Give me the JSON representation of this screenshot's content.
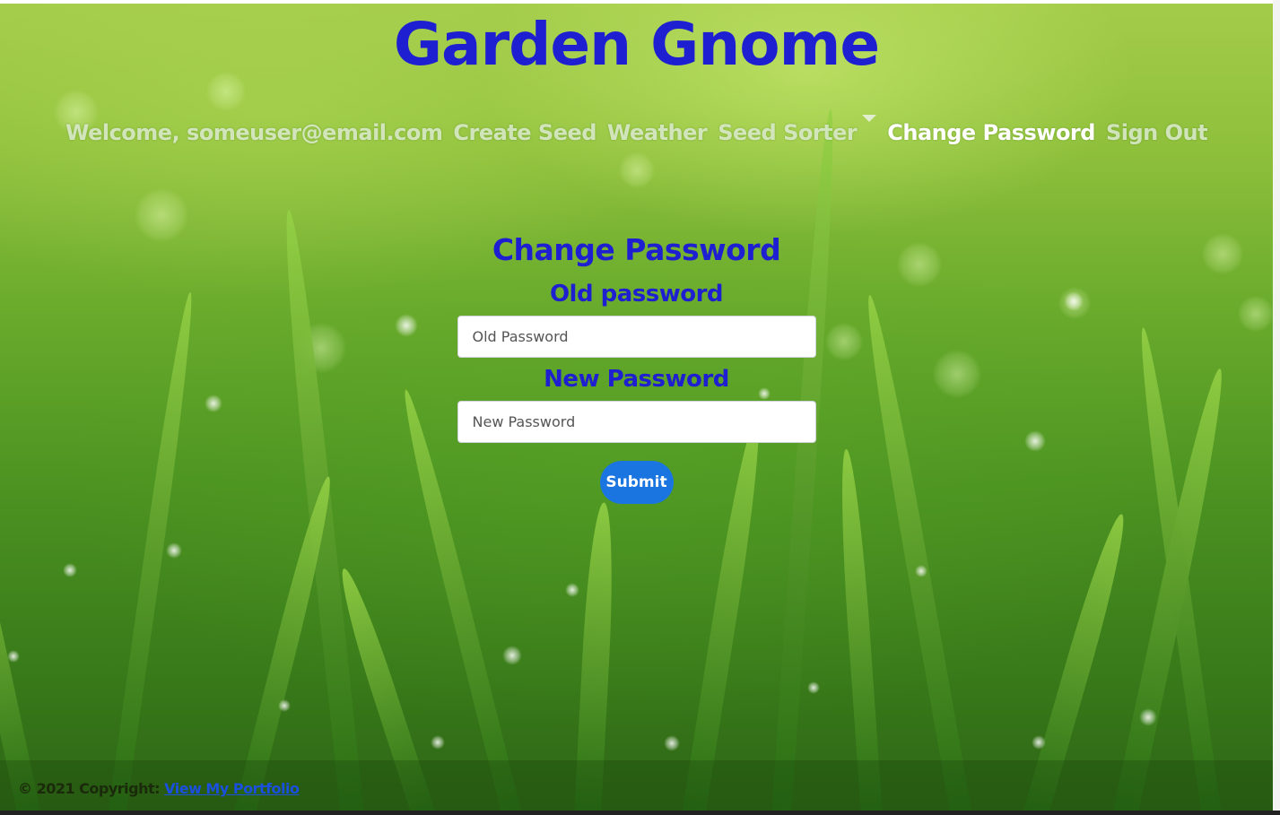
{
  "header": {
    "site_title": "Garden Gnome"
  },
  "nav": {
    "items": [
      {
        "label": "Welcome, someuser@email.com"
      },
      {
        "label": "Create Seed"
      },
      {
        "label": "Weather"
      },
      {
        "label": "Seed Sorter"
      },
      {
        "label": "Change Password"
      },
      {
        "label": "Sign Out"
      }
    ],
    "active": "Change Password"
  },
  "form": {
    "title": "Change Password",
    "old_label": "Old password",
    "old_placeholder": "Old Password",
    "new_label": "New Password",
    "new_placeholder": "New Password",
    "submit_label": "Submit"
  },
  "footer": {
    "copyright": "© 2021 Copyright: ",
    "link_label": "View My Portfolio"
  },
  "colors": {
    "title_blue": "#1f1fd2",
    "button_blue": "#1a75e0",
    "link_blue": "#1a4fe0"
  }
}
